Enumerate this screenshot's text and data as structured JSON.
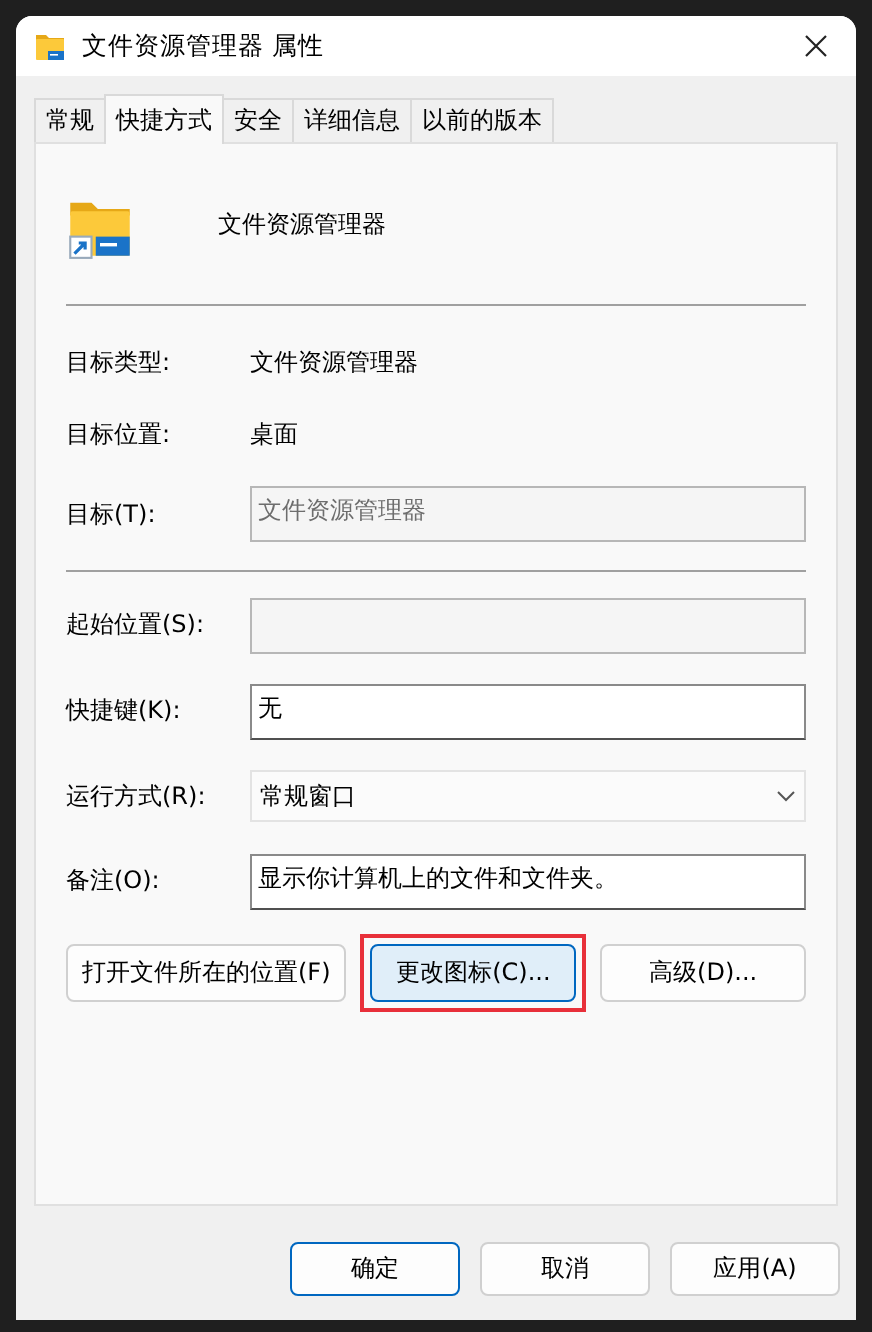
{
  "window": {
    "title": "文件资源管理器 属性"
  },
  "tabs": [
    {
      "label": "常规",
      "selected": false
    },
    {
      "label": "快捷方式",
      "selected": true
    },
    {
      "label": "安全",
      "selected": false
    },
    {
      "label": "详细信息",
      "selected": false
    },
    {
      "label": "以前的版本",
      "selected": false
    }
  ],
  "header": {
    "name": "文件资源管理器"
  },
  "rows_top": [
    {
      "kind": "text",
      "label": "目标类型:",
      "value": "文件资源管理器"
    },
    {
      "kind": "text",
      "label": "目标位置:",
      "value": "桌面"
    },
    {
      "kind": "field",
      "label": "目标(T):",
      "value": "文件资源管理器",
      "disabled": true
    }
  ],
  "rows_bottom": [
    {
      "kind": "field",
      "label": "起始位置(S):",
      "disabled": true
    },
    {
      "kind": "field",
      "label": "快捷键(K):",
      "value": "无",
      "disabled": false
    },
    {
      "kind": "dropdown",
      "label": "运行方式(R):",
      "value": "常规窗口"
    },
    {
      "kind": "field",
      "label": "备注(O):",
      "value": "显示你计算机上的文件和文件夹。",
      "disabled": false
    }
  ],
  "action_buttons": [
    {
      "label": "打开文件所在的位置(F)",
      "highlighted": false
    },
    {
      "label": "更改图标(C)...",
      "highlighted": true
    },
    {
      "label": "高级(D)...",
      "highlighted": false
    }
  ],
  "dialog_buttons": [
    {
      "label": "确定",
      "default": true
    },
    {
      "label": "取消",
      "default": false
    },
    {
      "label": "应用(A)",
      "default": false
    }
  ]
}
